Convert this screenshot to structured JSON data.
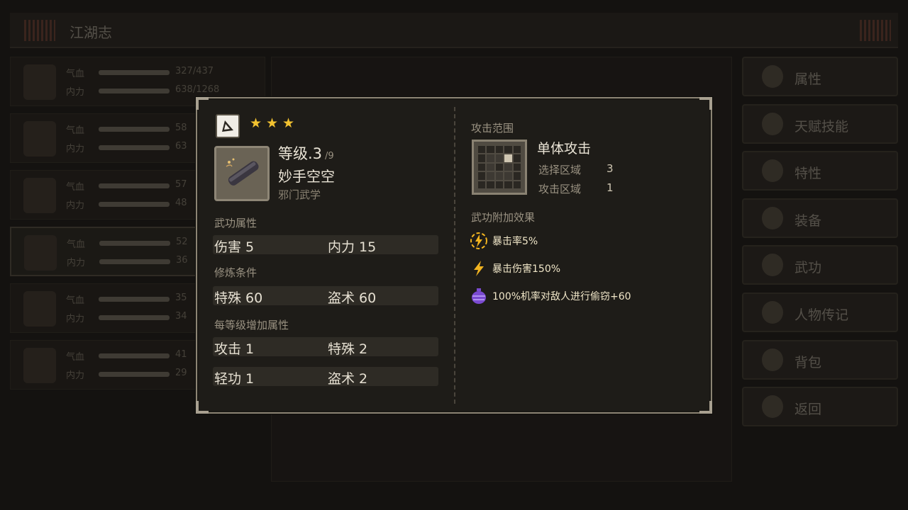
{
  "background": {
    "title": "江湖志",
    "roster": [
      {
        "hp_label": "气血",
        "mp_label": "内力",
        "hp": "327/437",
        "mp": "638/1268"
      },
      {
        "hp_label": "气血",
        "mp_label": "内力",
        "hp": "58",
        "mp": "63"
      },
      {
        "hp_label": "气血",
        "mp_label": "内力",
        "hp": "57",
        "mp": "48"
      },
      {
        "hp_label": "气血",
        "mp_label": "内力",
        "hp": "52",
        "mp": "36"
      },
      {
        "hp_label": "气血",
        "mp_label": "内力",
        "hp": "35",
        "mp": "34"
      },
      {
        "hp_label": "气血",
        "mp_label": "内力",
        "hp": "41",
        "mp": "29"
      }
    ],
    "menu": [
      "属性",
      "天赋技能",
      "特性",
      "装备",
      "武功",
      "人物传记",
      "背包",
      "返回"
    ]
  },
  "tooltip": {
    "stars": 3,
    "level_label": "等级.3",
    "level_max": "/9",
    "skill_name": "妙手空空",
    "skill_category": "邪门武学",
    "attr_title": "武功属性",
    "attrs": [
      {
        "name": "伤害",
        "value": "5"
      },
      {
        "name": "内力",
        "value": "15"
      }
    ],
    "req_title": "修炼条件",
    "reqs": [
      {
        "name": "特殊",
        "value": "60"
      },
      {
        "name": "盗术",
        "value": "60"
      }
    ],
    "growth_title": "每等级增加属性",
    "growth": [
      {
        "name": "攻击",
        "value": "1"
      },
      {
        "name": "特殊",
        "value": "2"
      },
      {
        "name": "轻功",
        "value": "1"
      },
      {
        "name": "盗术",
        "value": "2"
      }
    ],
    "range_title": "攻击范围",
    "range_name": "单体攻击",
    "select_label": "选择区域",
    "select_value": "3",
    "attack_label": "攻击区域",
    "attack_value": "1",
    "effects_title": "武功附加效果",
    "effects": [
      {
        "icon": "lightning-circle-icon",
        "text": "暴击率5%"
      },
      {
        "icon": "lightning-icon",
        "text": "暴击伤害150%"
      },
      {
        "icon": "steal-bag-icon",
        "text": "100%机率对敌人进行偷窃+60"
      }
    ],
    "colors": {
      "star": "#f2c230",
      "effect_icon": "#f2b420",
      "steal_icon": "#7a4ad0"
    }
  }
}
